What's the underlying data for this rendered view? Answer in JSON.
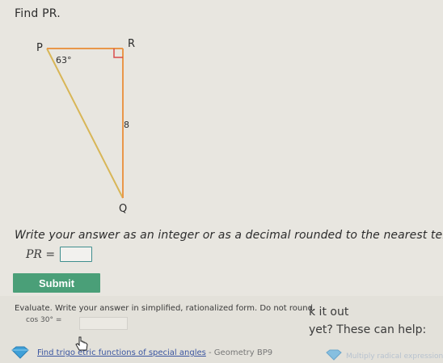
{
  "question": {
    "prompt": "Find PR.",
    "instruction": "Write your answer as an integer or as a decimal rounded to the nearest tenth.",
    "answer_label": "PR =",
    "answer_value": "",
    "submit_label": "Submit"
  },
  "diagram": {
    "vertex_p": "P",
    "vertex_r": "R",
    "vertex_q": "Q",
    "angle_label": "63°",
    "side_label": "8",
    "colors": {
      "hypotenuse": "#d8b657",
      "legs": "#e9974a",
      "right_angle_marker": "#d94a4a"
    }
  },
  "next_problem": {
    "text": "Evaluate. Write your answer in simplified, rationalized form. Do not round.",
    "expression": "cos 30° ="
  },
  "side_panel": {
    "fragment_1": "k it out",
    "fragment_2": "yet? These can help:"
  },
  "help": {
    "link_text": "Find trigo   etric functions of special angles",
    "meta": " - Geometry   BP9",
    "faded": "Multiply radical expressions"
  },
  "icons": {
    "gem": "gem-icon",
    "cursor": "hand-cursor-icon"
  },
  "colors": {
    "background": "#e8e6e0",
    "submit": "#4a9f78",
    "input_border": "#3f8e8e",
    "link": "#3a55a0"
  }
}
